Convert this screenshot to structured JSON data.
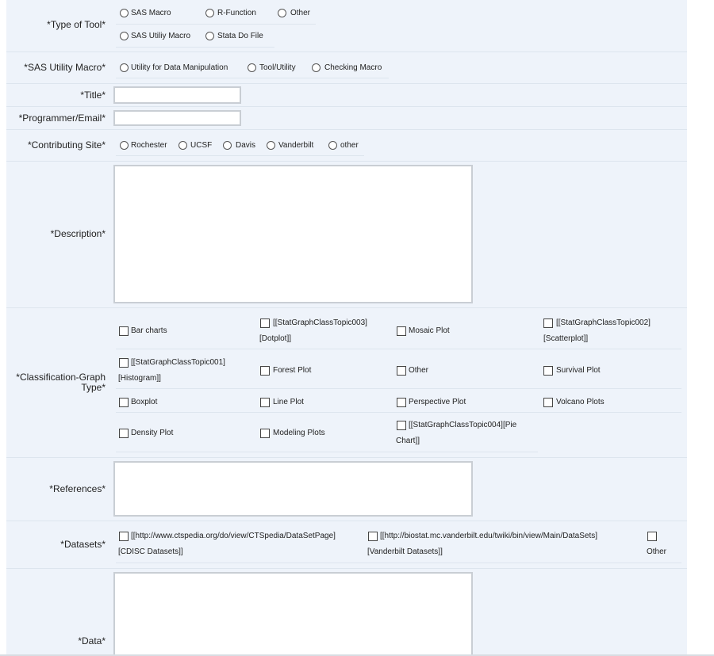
{
  "type_of_tool": {
    "label": "*Type of Tool*",
    "options": [
      "SAS Macro",
      "R-Function",
      "Other",
      "SAS Utiliy Macro",
      "Stata Do File"
    ]
  },
  "sas_utility_macro": {
    "label": "*SAS Utility Macro*",
    "options": [
      "Utility for Data Manipulation",
      "Tool/Utility",
      "Checking Macro"
    ]
  },
  "title": {
    "label": "*Title*",
    "value": ""
  },
  "programmer": {
    "label": "*Programmer/Email*",
    "value": ""
  },
  "contributing_site": {
    "label": "*Contributing Site*",
    "options": [
      "Rochester",
      "UCSF",
      "Davis",
      "Vanderbilt",
      "other"
    ]
  },
  "description": {
    "label": "*Description*",
    "value": ""
  },
  "classification": {
    "label_line1": "*Classification-Graph",
    "label_line2": "Type*",
    "options": [
      {
        "line1": "Bar charts",
        "line2": ""
      },
      {
        "line1": "[[StatGraphClassTopic003]",
        "line2": "[Dotplot]]"
      },
      {
        "line1": "Mosaic Plot",
        "line2": ""
      },
      {
        "line1": "[[StatGraphClassTopic002]",
        "line2": "[Scatterplot]]"
      },
      {
        "line1": "[[StatGraphClassTopic001]",
        "line2": "[Histogram]]"
      },
      {
        "line1": "Forest Plot",
        "line2": ""
      },
      {
        "line1": "Other",
        "line2": ""
      },
      {
        "line1": "Survival Plot",
        "line2": ""
      },
      {
        "line1": "Boxplot",
        "line2": ""
      },
      {
        "line1": "Line Plot",
        "line2": ""
      },
      {
        "line1": "Perspective Plot",
        "line2": ""
      },
      {
        "line1": "Volcano Plots",
        "line2": ""
      },
      {
        "line1": "Density Plot",
        "line2": ""
      },
      {
        "line1": "Modeling Plots",
        "line2": ""
      },
      {
        "line1": "[[StatGraphClassTopic004][Pie",
        "line2": "Chart]]"
      }
    ]
  },
  "references": {
    "label": "*References*",
    "value": ""
  },
  "datasets": {
    "label": "*Datasets*",
    "options": [
      {
        "line1": "[[http://www.ctspedia.org/do/view/CTSpedia/DataSetPage]",
        "line2": "[CDISC Datasets]]"
      },
      {
        "line1": "[[http://biostat.mc.vanderbilt.edu/twiki/bin/view/Main/DataSets]",
        "line2": "[Vanderbilt Datasets]]"
      },
      {
        "line1": "",
        "line2": "Other"
      }
    ]
  },
  "data": {
    "label": "*Data*",
    "value": ""
  }
}
